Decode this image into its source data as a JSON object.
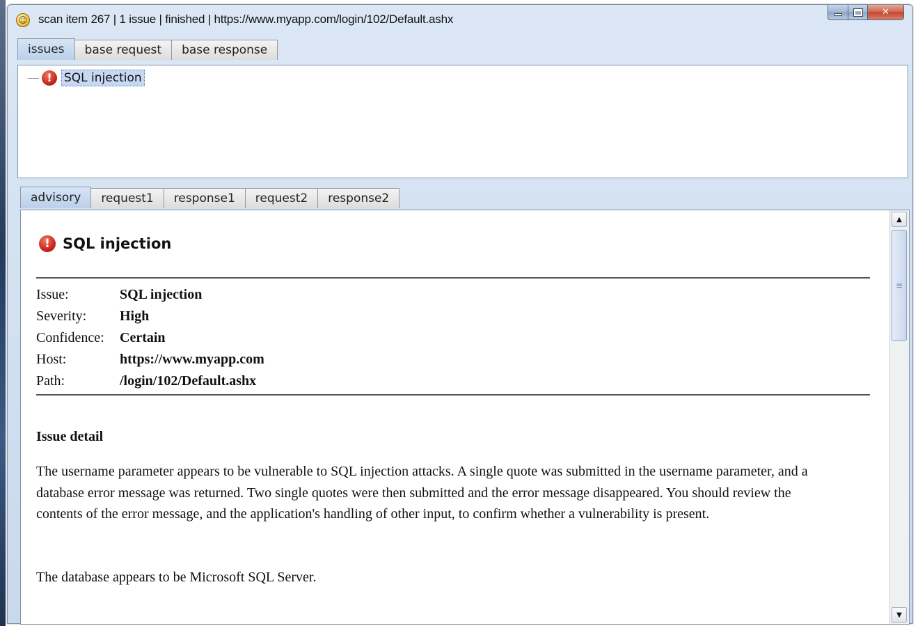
{
  "window": {
    "title": "scan item 267 | 1 issue | finished | https://www.myapp.com/login/102/Default.ashx"
  },
  "top_tabs": [
    {
      "label": "issues",
      "active": true
    },
    {
      "label": "base request",
      "active": false
    },
    {
      "label": "base response",
      "active": false
    }
  ],
  "issue_tree": {
    "items": [
      {
        "label": "SQL injection",
        "icon": "issue-high-icon",
        "selected": true
      }
    ]
  },
  "detail_tabs": [
    {
      "label": "advisory",
      "active": true
    },
    {
      "label": "request1",
      "active": false
    },
    {
      "label": "response1",
      "active": false
    },
    {
      "label": "request2",
      "active": false
    },
    {
      "label": "response2",
      "active": false
    }
  ],
  "advisory": {
    "title": "SQL injection",
    "fields": [
      {
        "key": "Issue:",
        "value": "SQL injection"
      },
      {
        "key": "Severity:",
        "value": "High"
      },
      {
        "key": "Confidence:",
        "value": "Certain"
      },
      {
        "key": "Host:",
        "value": "https://www.myapp.com"
      },
      {
        "key": "Path:",
        "value": "/login/102/Default.ashx"
      }
    ],
    "detail_heading": "Issue detail",
    "detail_paragraphs": [
      "The username parameter appears to be vulnerable to SQL injection attacks. A single quote was submitted in the username parameter, and a database error message was returned. Two single quotes were then submitted and the error message disappeared. You should review the contents of the error message, and the application's handling of other input, to confirm whether a vulnerability is present.",
      "The database appears to be Microsoft SQL Server."
    ]
  },
  "colors": {
    "severity_high": "#c4221a",
    "selection": "#c7d9f2",
    "active_tab": "#bcd0ea"
  }
}
